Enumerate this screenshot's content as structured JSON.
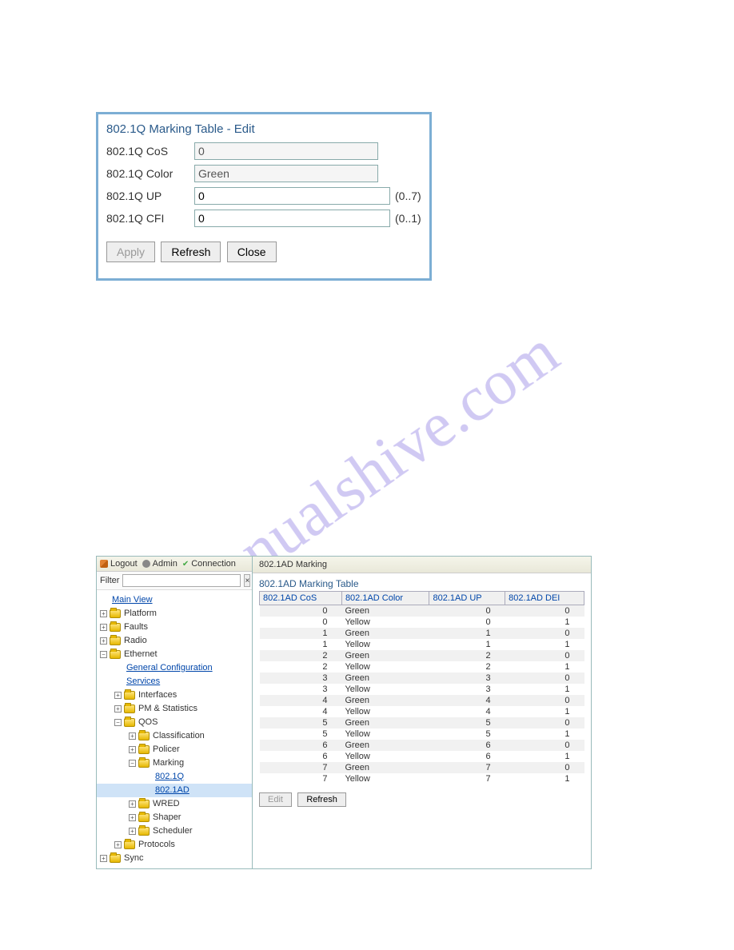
{
  "watermark": "manualshive.com",
  "dialog": {
    "title": "802.1Q Marking Table - Edit",
    "fields": {
      "cos": {
        "label": "802.1Q CoS",
        "value": "0",
        "hint": ""
      },
      "color": {
        "label": "802.1Q Color",
        "value": "Green",
        "hint": ""
      },
      "up": {
        "label": "802.1Q UP",
        "value": "0",
        "hint": "(0..7)"
      },
      "cfi": {
        "label": "802.1Q CFI",
        "value": "0",
        "hint": "(0..1)"
      }
    },
    "buttons": {
      "apply": "Apply",
      "refresh": "Refresh",
      "close": "Close"
    }
  },
  "toolbar": {
    "logout": "Logout",
    "admin": "Admin",
    "connection": "Connection"
  },
  "filter": {
    "label": "Filter",
    "value": ""
  },
  "tree": {
    "mainView": "Main View",
    "platform": "Platform",
    "faults": "Faults",
    "radio": "Radio",
    "ethernet": "Ethernet",
    "generalConfig": "General Configuration",
    "services": "Services",
    "interfaces": "Interfaces",
    "pmStats": "PM & Statistics",
    "qos": "QOS",
    "classification": "Classification",
    "policer": "Policer",
    "marking": "Marking",
    "m8021q": "802.1Q",
    "m8021ad": "802.1AD",
    "wred": "WRED",
    "shaper": "Shaper",
    "scheduler": "Scheduler",
    "protocols": "Protocols",
    "sync": "Sync"
  },
  "content": {
    "header": "802.1AD Marking",
    "panelTitle": "802.1AD Marking Table",
    "columns": [
      "802.1AD CoS",
      "802.1AD Color",
      "802.1AD UP",
      "802.1AD DEI"
    ],
    "rows": [
      {
        "cos": "0",
        "color": "Green",
        "up": "0",
        "dei": "0"
      },
      {
        "cos": "0",
        "color": "Yellow",
        "up": "0",
        "dei": "1"
      },
      {
        "cos": "1",
        "color": "Green",
        "up": "1",
        "dei": "0"
      },
      {
        "cos": "1",
        "color": "Yellow",
        "up": "1",
        "dei": "1"
      },
      {
        "cos": "2",
        "color": "Green",
        "up": "2",
        "dei": "0"
      },
      {
        "cos": "2",
        "color": "Yellow",
        "up": "2",
        "dei": "1"
      },
      {
        "cos": "3",
        "color": "Green",
        "up": "3",
        "dei": "0"
      },
      {
        "cos": "3",
        "color": "Yellow",
        "up": "3",
        "dei": "1"
      },
      {
        "cos": "4",
        "color": "Green",
        "up": "4",
        "dei": "0"
      },
      {
        "cos": "4",
        "color": "Yellow",
        "up": "4",
        "dei": "1"
      },
      {
        "cos": "5",
        "color": "Green",
        "up": "5",
        "dei": "0"
      },
      {
        "cos": "5",
        "color": "Yellow",
        "up": "5",
        "dei": "1"
      },
      {
        "cos": "6",
        "color": "Green",
        "up": "6",
        "dei": "0"
      },
      {
        "cos": "6",
        "color": "Yellow",
        "up": "6",
        "dei": "1"
      },
      {
        "cos": "7",
        "color": "Green",
        "up": "7",
        "dei": "0"
      },
      {
        "cos": "7",
        "color": "Yellow",
        "up": "7",
        "dei": "1"
      }
    ],
    "buttons": {
      "edit": "Edit",
      "refresh": "Refresh"
    }
  }
}
